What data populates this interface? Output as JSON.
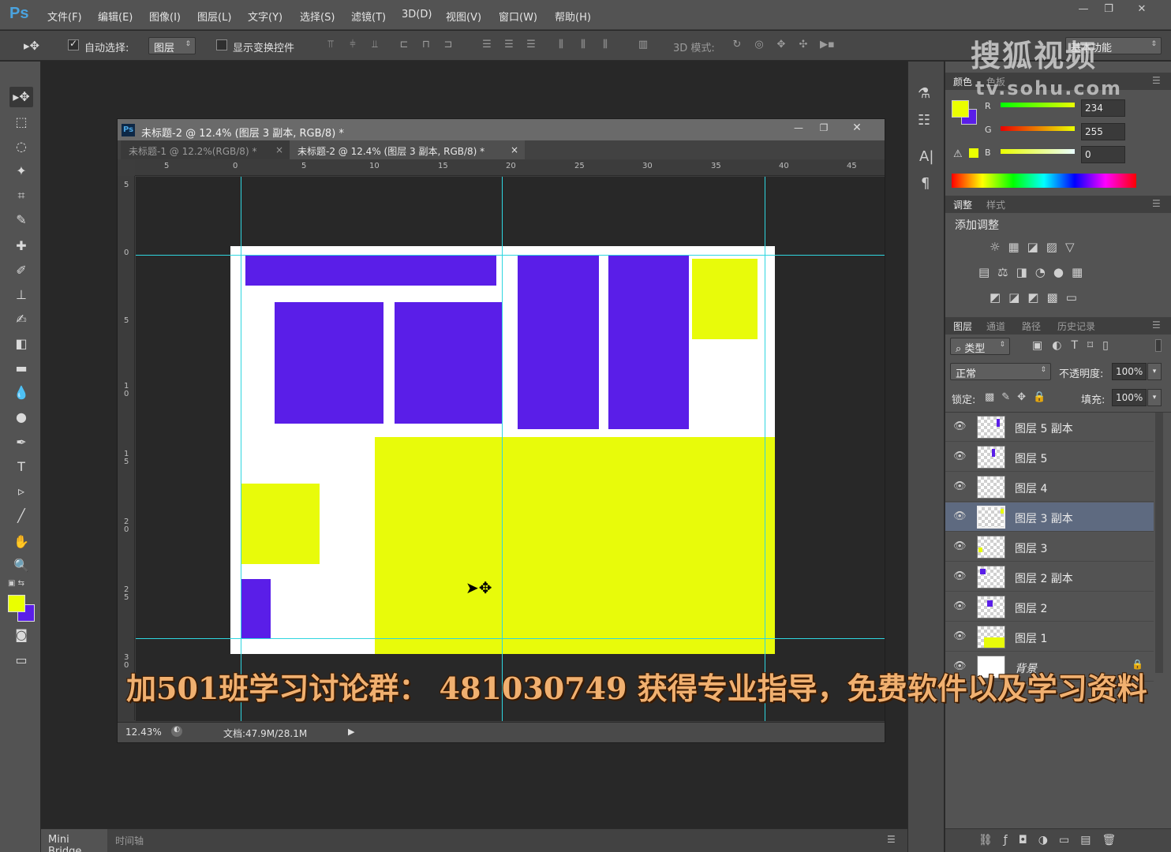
{
  "app": {
    "logo": "Ps",
    "menu": [
      "文件(F)",
      "编辑(E)",
      "图像(I)",
      "图层(L)",
      "文字(Y)",
      "选择(S)",
      "滤镜(T)",
      "3D(D)",
      "视图(V)",
      "窗口(W)",
      "帮助(H)"
    ],
    "window_controls": [
      "—",
      "❐",
      "✕"
    ]
  },
  "options_bar": {
    "auto_select_label": "自动选择:",
    "auto_select_checked": true,
    "auto_select_target": "图层",
    "show_transform_label": "显示变换控件",
    "show_transform_checked": false,
    "mode_3d_label": "3D 模式:",
    "workspace": "基本功能"
  },
  "document": {
    "title": "未标题-2 @ 12.4% (图层 3 副本, RGB/8) *",
    "tabs": [
      {
        "label": "未标题-1 @ 12.2%(RGB/8) *",
        "active": false
      },
      {
        "label": "未标题-2 @ 12.4% (图层 3 副本, RGB/8) *",
        "active": true
      }
    ],
    "ruler_top_labels": [
      "5",
      "0",
      "5",
      "10",
      "15",
      "20",
      "25",
      "30",
      "35",
      "40",
      "45"
    ],
    "ruler_left_labels": [
      "5",
      "0",
      "5",
      "1\n0",
      "1\n5",
      "2\n0",
      "2\n5",
      "3\n0"
    ],
    "zoom": "12.43%",
    "doc_size": "文档:47.9M/28.1M"
  },
  "colors": {
    "purple": "#5a1ee8",
    "yellow": "#e8fb0a",
    "foreground": "#eaff00",
    "background": "#5a1ee8",
    "guide": "#2fd6e0"
  },
  "color_panel": {
    "tabs": [
      "颜色",
      "色板"
    ],
    "r_label": "R",
    "g_label": "G",
    "b_label": "B",
    "r": "234",
    "g": "255",
    "b": "0"
  },
  "adjust_panel": {
    "tabs": [
      "调整",
      "样式"
    ],
    "heading": "添加调整"
  },
  "layers_panel": {
    "tabs": [
      "图层",
      "通道",
      "路径",
      "历史记录"
    ],
    "filter_kind": "类型",
    "blend_mode": "正常",
    "opacity_label": "不透明度:",
    "opacity": "100%",
    "lock_label": "锁定:",
    "fill_label": "填充:",
    "fill": "100%",
    "layers": [
      {
        "name": "图层 5 副本",
        "selected": false
      },
      {
        "name": "图层 5",
        "selected": false
      },
      {
        "name": "图层 4",
        "selected": false
      },
      {
        "name": "图层 3 副本",
        "selected": true
      },
      {
        "name": "图层 3",
        "selected": false
      },
      {
        "name": "图层 2 副本",
        "selected": false
      },
      {
        "name": "图层 2",
        "selected": false
      },
      {
        "name": "图层 1",
        "selected": false
      },
      {
        "name": "背景",
        "selected": false
      }
    ]
  },
  "bottom_bar": {
    "tabs": [
      "Mini Bridge",
      "时间轴"
    ]
  },
  "watermark": {
    "line1": "搜狐视频",
    "line2": "tv.sohu.com"
  },
  "subtitle": "加501班学习讨论群： 481030749 获得专业指导，免费软件以及学习资料"
}
